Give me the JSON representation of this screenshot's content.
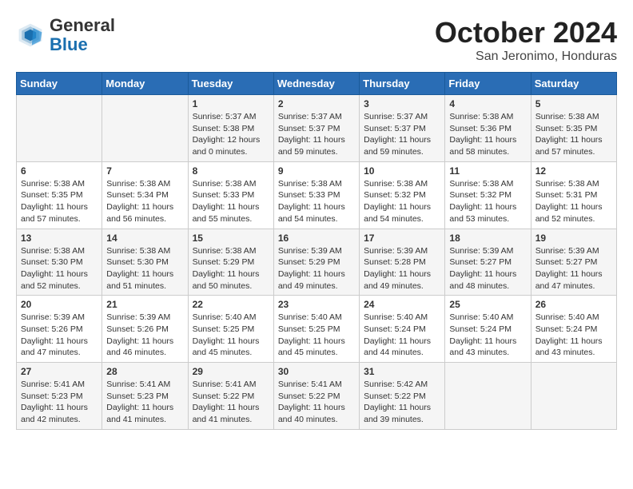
{
  "header": {
    "logo_general": "General",
    "logo_blue": "Blue",
    "month_title": "October 2024",
    "location": "San Jeronimo, Honduras"
  },
  "days_of_week": [
    "Sunday",
    "Monday",
    "Tuesday",
    "Wednesday",
    "Thursday",
    "Friday",
    "Saturday"
  ],
  "weeks": [
    [
      {
        "day": "",
        "info": ""
      },
      {
        "day": "",
        "info": ""
      },
      {
        "day": "1",
        "info": "Sunrise: 5:37 AM\nSunset: 5:38 PM\nDaylight: 12 hours\nand 0 minutes."
      },
      {
        "day": "2",
        "info": "Sunrise: 5:37 AM\nSunset: 5:37 PM\nDaylight: 11 hours\nand 59 minutes."
      },
      {
        "day": "3",
        "info": "Sunrise: 5:37 AM\nSunset: 5:37 PM\nDaylight: 11 hours\nand 59 minutes."
      },
      {
        "day": "4",
        "info": "Sunrise: 5:38 AM\nSunset: 5:36 PM\nDaylight: 11 hours\nand 58 minutes."
      },
      {
        "day": "5",
        "info": "Sunrise: 5:38 AM\nSunset: 5:35 PM\nDaylight: 11 hours\nand 57 minutes."
      }
    ],
    [
      {
        "day": "6",
        "info": "Sunrise: 5:38 AM\nSunset: 5:35 PM\nDaylight: 11 hours\nand 57 minutes."
      },
      {
        "day": "7",
        "info": "Sunrise: 5:38 AM\nSunset: 5:34 PM\nDaylight: 11 hours\nand 56 minutes."
      },
      {
        "day": "8",
        "info": "Sunrise: 5:38 AM\nSunset: 5:33 PM\nDaylight: 11 hours\nand 55 minutes."
      },
      {
        "day": "9",
        "info": "Sunrise: 5:38 AM\nSunset: 5:33 PM\nDaylight: 11 hours\nand 54 minutes."
      },
      {
        "day": "10",
        "info": "Sunrise: 5:38 AM\nSunset: 5:32 PM\nDaylight: 11 hours\nand 54 minutes."
      },
      {
        "day": "11",
        "info": "Sunrise: 5:38 AM\nSunset: 5:32 PM\nDaylight: 11 hours\nand 53 minutes."
      },
      {
        "day": "12",
        "info": "Sunrise: 5:38 AM\nSunset: 5:31 PM\nDaylight: 11 hours\nand 52 minutes."
      }
    ],
    [
      {
        "day": "13",
        "info": "Sunrise: 5:38 AM\nSunset: 5:30 PM\nDaylight: 11 hours\nand 52 minutes."
      },
      {
        "day": "14",
        "info": "Sunrise: 5:38 AM\nSunset: 5:30 PM\nDaylight: 11 hours\nand 51 minutes."
      },
      {
        "day": "15",
        "info": "Sunrise: 5:38 AM\nSunset: 5:29 PM\nDaylight: 11 hours\nand 50 minutes."
      },
      {
        "day": "16",
        "info": "Sunrise: 5:39 AM\nSunset: 5:29 PM\nDaylight: 11 hours\nand 49 minutes."
      },
      {
        "day": "17",
        "info": "Sunrise: 5:39 AM\nSunset: 5:28 PM\nDaylight: 11 hours\nand 49 minutes."
      },
      {
        "day": "18",
        "info": "Sunrise: 5:39 AM\nSunset: 5:27 PM\nDaylight: 11 hours\nand 48 minutes."
      },
      {
        "day": "19",
        "info": "Sunrise: 5:39 AM\nSunset: 5:27 PM\nDaylight: 11 hours\nand 47 minutes."
      }
    ],
    [
      {
        "day": "20",
        "info": "Sunrise: 5:39 AM\nSunset: 5:26 PM\nDaylight: 11 hours\nand 47 minutes."
      },
      {
        "day": "21",
        "info": "Sunrise: 5:39 AM\nSunset: 5:26 PM\nDaylight: 11 hours\nand 46 minutes."
      },
      {
        "day": "22",
        "info": "Sunrise: 5:40 AM\nSunset: 5:25 PM\nDaylight: 11 hours\nand 45 minutes."
      },
      {
        "day": "23",
        "info": "Sunrise: 5:40 AM\nSunset: 5:25 PM\nDaylight: 11 hours\nand 45 minutes."
      },
      {
        "day": "24",
        "info": "Sunrise: 5:40 AM\nSunset: 5:24 PM\nDaylight: 11 hours\nand 44 minutes."
      },
      {
        "day": "25",
        "info": "Sunrise: 5:40 AM\nSunset: 5:24 PM\nDaylight: 11 hours\nand 43 minutes."
      },
      {
        "day": "26",
        "info": "Sunrise: 5:40 AM\nSunset: 5:24 PM\nDaylight: 11 hours\nand 43 minutes."
      }
    ],
    [
      {
        "day": "27",
        "info": "Sunrise: 5:41 AM\nSunset: 5:23 PM\nDaylight: 11 hours\nand 42 minutes."
      },
      {
        "day": "28",
        "info": "Sunrise: 5:41 AM\nSunset: 5:23 PM\nDaylight: 11 hours\nand 41 minutes."
      },
      {
        "day": "29",
        "info": "Sunrise: 5:41 AM\nSunset: 5:22 PM\nDaylight: 11 hours\nand 41 minutes."
      },
      {
        "day": "30",
        "info": "Sunrise: 5:41 AM\nSunset: 5:22 PM\nDaylight: 11 hours\nand 40 minutes."
      },
      {
        "day": "31",
        "info": "Sunrise: 5:42 AM\nSunset: 5:22 PM\nDaylight: 11 hours\nand 39 minutes."
      },
      {
        "day": "",
        "info": ""
      },
      {
        "day": "",
        "info": ""
      }
    ]
  ]
}
